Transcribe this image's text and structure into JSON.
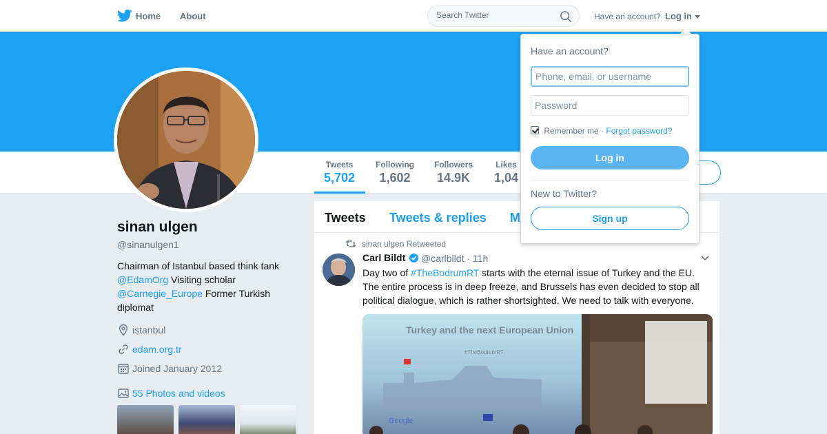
{
  "nav": {
    "home": "Home",
    "about": "About",
    "search_placeholder": "Search Twitter",
    "have_account": "Have an account?",
    "login": "Log in"
  },
  "stats": [
    {
      "label": "Tweets",
      "value": "5,702"
    },
    {
      "label": "Following",
      "value": "1,602"
    },
    {
      "label": "Followers",
      "value": "14.9K"
    },
    {
      "label": "Likes",
      "value": "1,04"
    }
  ],
  "profile": {
    "name": "sinan ulgen",
    "handle": "@sinanulgen1",
    "bio_1": "Chairman of Istanbul based think tank",
    "bio_mention_1": "@EdamOrg",
    "bio_2": "Visiting scholar",
    "bio_mention_2": "@Carnegie_Europe",
    "bio_3": "Former Turkish diplomat",
    "location": "istanbul",
    "website": "edam.org.tr",
    "joined": "Joined January 2012",
    "photos": "55 Photos and videos"
  },
  "timeline": {
    "tabs": [
      "Tweets",
      "Tweets & replies",
      "M"
    ],
    "retweet_context": "sinan ulgen Retweeted",
    "tweet": {
      "author": "Carl Bildt",
      "handle": "@carlbildt",
      "time": "11h",
      "text_1": "Day two of",
      "hashtag": "#TheBodrumRT",
      "text_2": "starts with the eternal issue of Turkey and the EU. The entire process is in deep freeze, and Brussels has even decided to stop all political dialogue, which is rather shortsighted. We need to talk with everyone.",
      "media_title": "Turkey and the next European Union",
      "media_subtitle": "#TheBodrumRT",
      "media_brand": "Google"
    }
  },
  "login_dropdown": {
    "heading": "Have an account?",
    "username_placeholder": "Phone, email, or username",
    "password_placeholder": "Password",
    "remember": "Remember me",
    "separator": "·",
    "forgot": "Forgot password?",
    "login_button": "Log in",
    "new_to": "New to Twitter?",
    "signup_button": "Sign up"
  },
  "colors": {
    "brand": "#1da1f2",
    "background": "#e6ecf0",
    "muted": "#657786"
  }
}
